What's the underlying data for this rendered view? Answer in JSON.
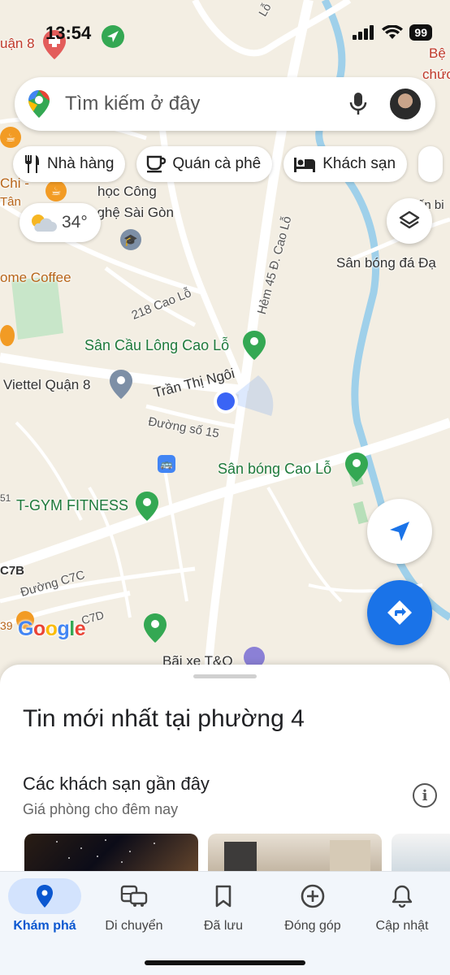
{
  "status_bar": {
    "time": "13:54",
    "battery": "99"
  },
  "search": {
    "placeholder": "Tìm kiếm ở đây"
  },
  "chips": [
    {
      "label": "Nhà hàng",
      "icon": "restaurant-icon"
    },
    {
      "label": "Quán cà phê",
      "icon": "coffee-icon"
    },
    {
      "label": "Khách sạn",
      "icon": "hotel-icon"
    }
  ],
  "weather": {
    "temp": "34°"
  },
  "map_labels": {
    "quan8": "uận 8",
    "benh_top": "Bệ",
    "benh_bottom": "chức",
    "chi": "Chi -",
    "tan": "Tân",
    "hoc_cong": "học Công",
    "nghe_sai_gon": "nghệ Sài Gòn",
    "home_coffee": "ome Coffee",
    "san_bong_dai": "Sân bóng đá Đạ",
    "ben": "ến bi",
    "cao_lo_218": "218 Cao Lỗ",
    "hem45": "Hẻm 45 Đ. Cao Lỗ",
    "san_cau_long": "Sân Cầu Lông Cao Lỗ",
    "viettel": "Viettel Quận 8",
    "tran_thi_ngoi": "Trần Thị Ngôi",
    "duong_so_15": "Đường số 15",
    "san_bong_cao_lo": "Sân bóng Cao Lỗ",
    "tgym": "T-GYM FITNESS",
    "c7b": "C7B",
    "duong_c7c": "Đường C7C",
    "c7d": "C7D",
    "num39": "39",
    "num51": "51",
    "bai_xe": "Bãi xe T&Q",
    "lo": "Lỗ"
  },
  "google_logo": "Google",
  "sheet": {
    "title": "Tin mới nhất tại phường 4",
    "section_title": "Các khách sạn gần đây",
    "section_sub": "Giá phòng cho đêm nay"
  },
  "nav": [
    {
      "label": "Khám phá",
      "icon": "explore-pin-icon",
      "active": true
    },
    {
      "label": "Di chuyển",
      "icon": "commute-icon"
    },
    {
      "label": "Đã lưu",
      "icon": "bookmark-icon"
    },
    {
      "label": "Đóng góp",
      "icon": "add-circle-icon"
    },
    {
      "label": "Cập nhật",
      "icon": "bell-icon"
    }
  ]
}
